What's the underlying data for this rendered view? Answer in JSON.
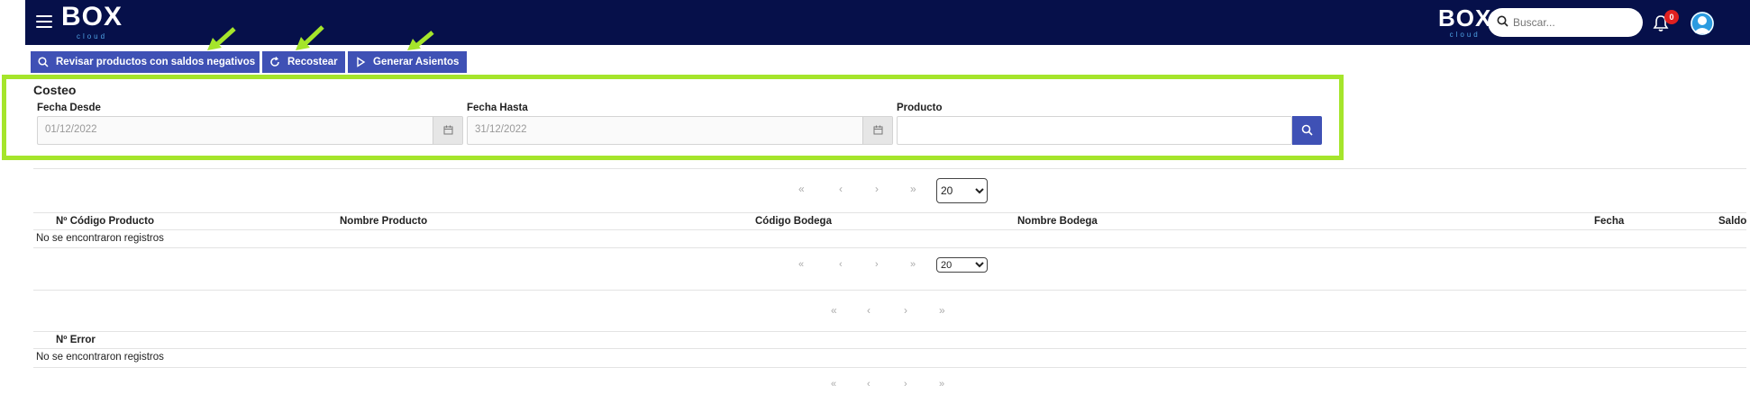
{
  "header": {
    "logo_text": "BOX",
    "logo_sub": "cloud",
    "search_placeholder": "Buscar...",
    "notification_count": "0"
  },
  "toolbar": {
    "buttons": [
      {
        "label": "Revisar productos con saldos negativos",
        "icon": "search-icon"
      },
      {
        "label": "Recostear",
        "icon": "refresh-icon"
      },
      {
        "label": "Generar Asientos",
        "icon": "play-icon"
      }
    ],
    "annotation_color": "#a5e52b"
  },
  "costeo": {
    "title": "Costeo",
    "fecha_desde": {
      "label": "Fecha Desde",
      "value": "01/12/2022"
    },
    "fecha_hasta": {
      "label": "Fecha Hasta",
      "value": "31/12/2022"
    },
    "producto": {
      "label": "Producto",
      "value": ""
    }
  },
  "table1": {
    "pager_top": {
      "first": "«",
      "prev": "‹",
      "next": "›",
      "last": "»",
      "page_size": "20"
    },
    "columns": [
      "Nº Código Producto",
      "Nombre Producto",
      "Código Bodega",
      "Nombre Bodega",
      "Fecha",
      "Saldo"
    ],
    "empty_text": "No se encontraron registros",
    "pager_bottom": {
      "first": "«",
      "prev": "‹",
      "next": "›",
      "last": "»",
      "page_size": "20"
    }
  },
  "table2": {
    "pager_top": {
      "first": "«",
      "prev": "‹",
      "next": "›",
      "last": "»"
    },
    "columns": [
      "Nº Error"
    ],
    "empty_text": "No se encontraron registros",
    "pager_bottom": {
      "first": "«",
      "prev": "‹",
      "next": "›",
      "last": "»"
    }
  },
  "colors": {
    "navbar": "#06104a",
    "primary": "#3f51b5",
    "highlight": "#a5e52b",
    "badge": "#e02020"
  }
}
